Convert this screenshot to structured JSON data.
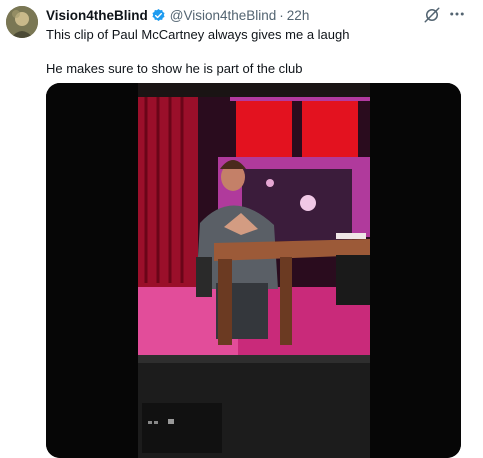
{
  "tweet": {
    "author_name": "Vision4theBlind",
    "handle": "@Vision4theBlind",
    "separator": "·",
    "time": "22h",
    "line1": "This clip of Paul McCartney always gives me a laugh",
    "line2": "He makes sure to show he is part of the club"
  },
  "icons": {
    "verified": "verified-badge-icon",
    "grok": "grok-icon",
    "more": "more-options-icon"
  },
  "colors": {
    "verified": "#1d9bf0",
    "text": "#0f1419",
    "secondary": "#536471"
  }
}
